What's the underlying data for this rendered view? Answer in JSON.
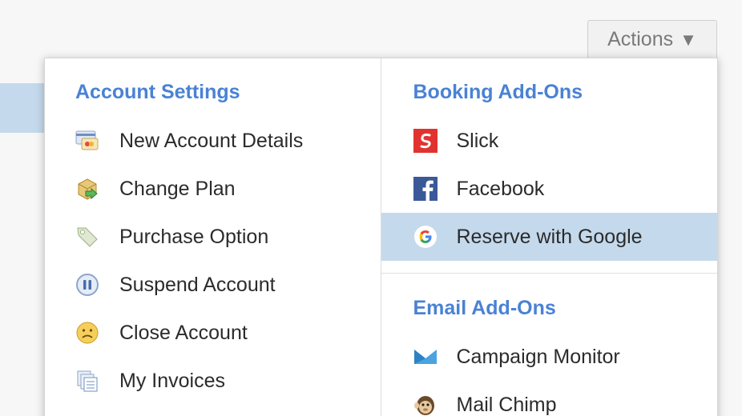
{
  "actions": {
    "label": "Actions",
    "caret": "▼"
  },
  "left": {
    "title": "Account Settings",
    "items": [
      {
        "label": "New Account Details",
        "icon": "credit-card-icon"
      },
      {
        "label": "Change Plan",
        "icon": "box-arrow-icon"
      },
      {
        "label": "Purchase Option",
        "icon": "tag-icon"
      },
      {
        "label": "Suspend Account",
        "icon": "pause-icon"
      },
      {
        "label": "Close Account",
        "icon": "sad-face-icon"
      },
      {
        "label": "My Invoices",
        "icon": "invoices-icon"
      }
    ]
  },
  "right": {
    "booking_title": "Booking Add-Ons",
    "booking_items": [
      {
        "label": "Slick",
        "icon": "slick-icon"
      },
      {
        "label": "Facebook",
        "icon": "facebook-icon"
      },
      {
        "label": "Reserve with Google",
        "icon": "google-icon"
      }
    ],
    "email_title": "Email Add-Ons",
    "email_items": [
      {
        "label": "Campaign Monitor",
        "icon": "campaign-monitor-icon"
      },
      {
        "label": "Mail Chimp",
        "icon": "mail-chimp-icon"
      }
    ]
  },
  "colors": {
    "accent": "#4a82d4",
    "selected": "#c4d9ec",
    "slick": "#e2322f",
    "facebook": "#3b5998"
  }
}
